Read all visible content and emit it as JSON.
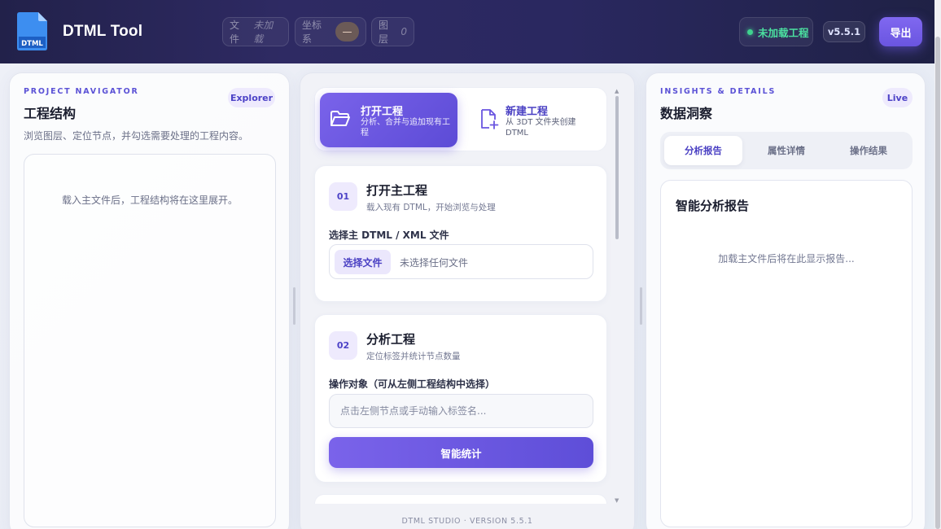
{
  "header": {
    "logo_text": "DTML",
    "app_title": "DTML Tool",
    "file": {
      "label": "文件",
      "value": "未加载"
    },
    "coord": {
      "label": "坐标系",
      "value": "—"
    },
    "layer": {
      "label": "图层",
      "value": "0"
    },
    "status": "未加载工程",
    "version": "v5.5.1",
    "export_label": "导出"
  },
  "navigator": {
    "kicker": "PROJECT NAVIGATOR",
    "title": "工程结构",
    "tag": "Explorer",
    "description": "浏览图层、定位节点，并勾选需要处理的工程内容。",
    "empty_text": "载入主文件后，工程结构将在这里展开。"
  },
  "workflow": {
    "modes": [
      {
        "label": "打开工程",
        "sub": "分析、合并与追加现有工程",
        "icon": "folder-open-icon",
        "active": true
      },
      {
        "label": "新建工程",
        "sub": "从 3DT 文件夹创建 DTML",
        "icon": "file-plus-icon",
        "active": false
      }
    ],
    "step1": {
      "number": "01",
      "title": "打开主工程",
      "subtitle": "载入现有 DTML，开始浏览与处理",
      "field_label": "选择主 DTML / XML 文件",
      "file_button": "选择文件",
      "file_status": "未选择任何文件"
    },
    "step2": {
      "number": "02",
      "title": "分析工程",
      "subtitle": "定位标签并统计节点数量",
      "field_label": "操作对象（可从左侧工程结构中选择）",
      "placeholder": "点击左侧节点或手动输入标签名...",
      "button": "智能统计"
    },
    "footer": "DTML STUDIO · VERSION 5.5.1"
  },
  "insights": {
    "kicker": "INSIGHTS & DETAILS",
    "title": "数据洞察",
    "tag": "Live",
    "tabs": [
      {
        "label": "分析报告",
        "active": true
      },
      {
        "label": "属性详情",
        "active": false
      },
      {
        "label": "操作结果",
        "active": false
      }
    ],
    "report_title": "智能分析报告",
    "report_empty": "加载主文件后将在此显示报告..."
  },
  "colors": {
    "accent": "#6a55e0",
    "status_green": "#3fd28f",
    "header_bg": "#2a2860"
  }
}
